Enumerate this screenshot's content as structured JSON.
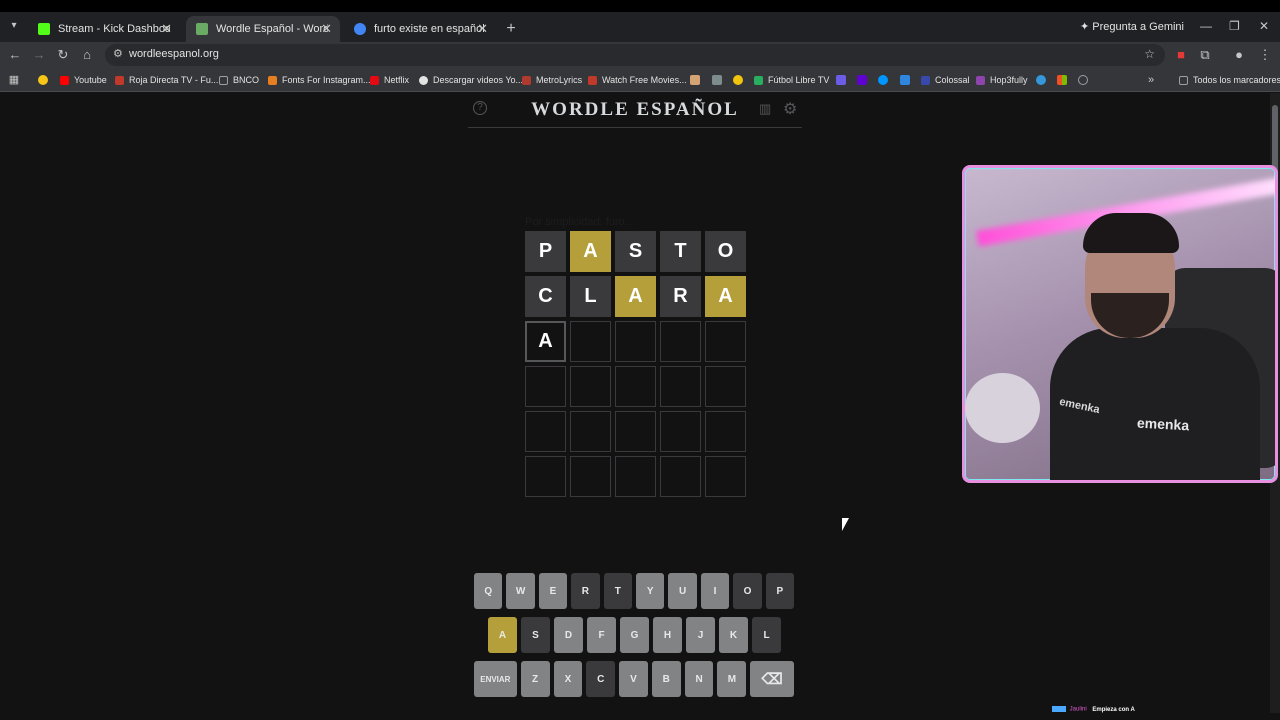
{
  "browser": {
    "tabs": [
      {
        "title": "Stream - Kick Dashboard",
        "favicon_color": "#53fc18",
        "active": false
      },
      {
        "title": "Wordle Español - Wordle ilimitado",
        "favicon_color": "#6aaa64",
        "active": true
      },
      {
        "title": "furto existe en español - Buscar con Google",
        "favicon_color": "#4285f4",
        "active": false
      }
    ],
    "gemini_label": "Pregunta a Gemini",
    "url": "wordleespanol.org",
    "bookmarks": [
      {
        "label": "Youtube",
        "color": "#ff0000"
      },
      {
        "label": "Roja Directa TV - Fu...",
        "color": "#c0392b"
      },
      {
        "label": "BNCO",
        "color": "#9aa0a6"
      },
      {
        "label": "Fonts For Instagram...",
        "color": "#e67e22"
      },
      {
        "label": "Netflix",
        "color": "#e50914"
      },
      {
        "label": "Descargar videos Yo...",
        "color": "#e3e3e3"
      },
      {
        "label": "MetroLyrics",
        "color": "#b03a2e"
      },
      {
        "label": "Watch Free Movies...",
        "color": "#c0392b"
      },
      {
        "label": "Fútbol Libre TV",
        "color": "#27ae60"
      },
      {
        "label": "Colossal",
        "color": "#3949ab"
      },
      {
        "label": "Hop3fully",
        "color": "#8e44ad"
      },
      {
        "label": "Todos los marcadores",
        "color": "#9aa0a6"
      }
    ]
  },
  "game": {
    "title": "WORDLE ESPAÑOL",
    "faint_message": "Por simplicidad, furo...",
    "grid": [
      [
        {
          "l": "P",
          "s": "absent"
        },
        {
          "l": "A",
          "s": "present"
        },
        {
          "l": "S",
          "s": "absent"
        },
        {
          "l": "T",
          "s": "absent"
        },
        {
          "l": "O",
          "s": "absent"
        }
      ],
      [
        {
          "l": "C",
          "s": "absent"
        },
        {
          "l": "L",
          "s": "absent"
        },
        {
          "l": "A",
          "s": "present"
        },
        {
          "l": "R",
          "s": "absent"
        },
        {
          "l": "A",
          "s": "present"
        }
      ],
      [
        {
          "l": "A",
          "s": "filled"
        },
        {
          "l": "",
          "s": "empty"
        },
        {
          "l": "",
          "s": "empty"
        },
        {
          "l": "",
          "s": "empty"
        },
        {
          "l": "",
          "s": "empty"
        }
      ],
      [
        {
          "l": "",
          "s": "empty"
        },
        {
          "l": "",
          "s": "empty"
        },
        {
          "l": "",
          "s": "empty"
        },
        {
          "l": "",
          "s": "empty"
        },
        {
          "l": "",
          "s": "empty"
        }
      ],
      [
        {
          "l": "",
          "s": "empty"
        },
        {
          "l": "",
          "s": "empty"
        },
        {
          "l": "",
          "s": "empty"
        },
        {
          "l": "",
          "s": "empty"
        },
        {
          "l": "",
          "s": "empty"
        }
      ],
      [
        {
          "l": "",
          "s": "empty"
        },
        {
          "l": "",
          "s": "empty"
        },
        {
          "l": "",
          "s": "empty"
        },
        {
          "l": "",
          "s": "empty"
        },
        {
          "l": "",
          "s": "empty"
        }
      ]
    ],
    "keyboard": [
      [
        {
          "k": "Q",
          "s": "unused"
        },
        {
          "k": "W",
          "s": "unused"
        },
        {
          "k": "E",
          "s": "unused"
        },
        {
          "k": "R",
          "s": "absent"
        },
        {
          "k": "T",
          "s": "absent"
        },
        {
          "k": "Y",
          "s": "unused"
        },
        {
          "k": "U",
          "s": "unused"
        },
        {
          "k": "I",
          "s": "unused"
        },
        {
          "k": "O",
          "s": "absent"
        },
        {
          "k": "P",
          "s": "absent"
        }
      ],
      [
        {
          "k": "A",
          "s": "present"
        },
        {
          "k": "S",
          "s": "absent"
        },
        {
          "k": "D",
          "s": "unused"
        },
        {
          "k": "F",
          "s": "unused"
        },
        {
          "k": "G",
          "s": "unused"
        },
        {
          "k": "H",
          "s": "unused"
        },
        {
          "k": "J",
          "s": "unused"
        },
        {
          "k": "K",
          "s": "unused"
        },
        {
          "k": "L",
          "s": "absent"
        }
      ],
      [
        {
          "k": "ENVIAR",
          "s": "unused"
        },
        {
          "k": "Z",
          "s": "unused"
        },
        {
          "k": "X",
          "s": "unused"
        },
        {
          "k": "C",
          "s": "absent"
        },
        {
          "k": "V",
          "s": "unused"
        },
        {
          "k": "B",
          "s": "unused"
        },
        {
          "k": "N",
          "s": "unused"
        },
        {
          "k": "M",
          "s": "unused"
        },
        {
          "k": "⌫",
          "s": "unused"
        }
      ]
    ]
  },
  "webcam": {
    "logo_text": "emenka"
  },
  "overlay": {
    "user": "Jaulini",
    "message": "Empieza con A"
  }
}
